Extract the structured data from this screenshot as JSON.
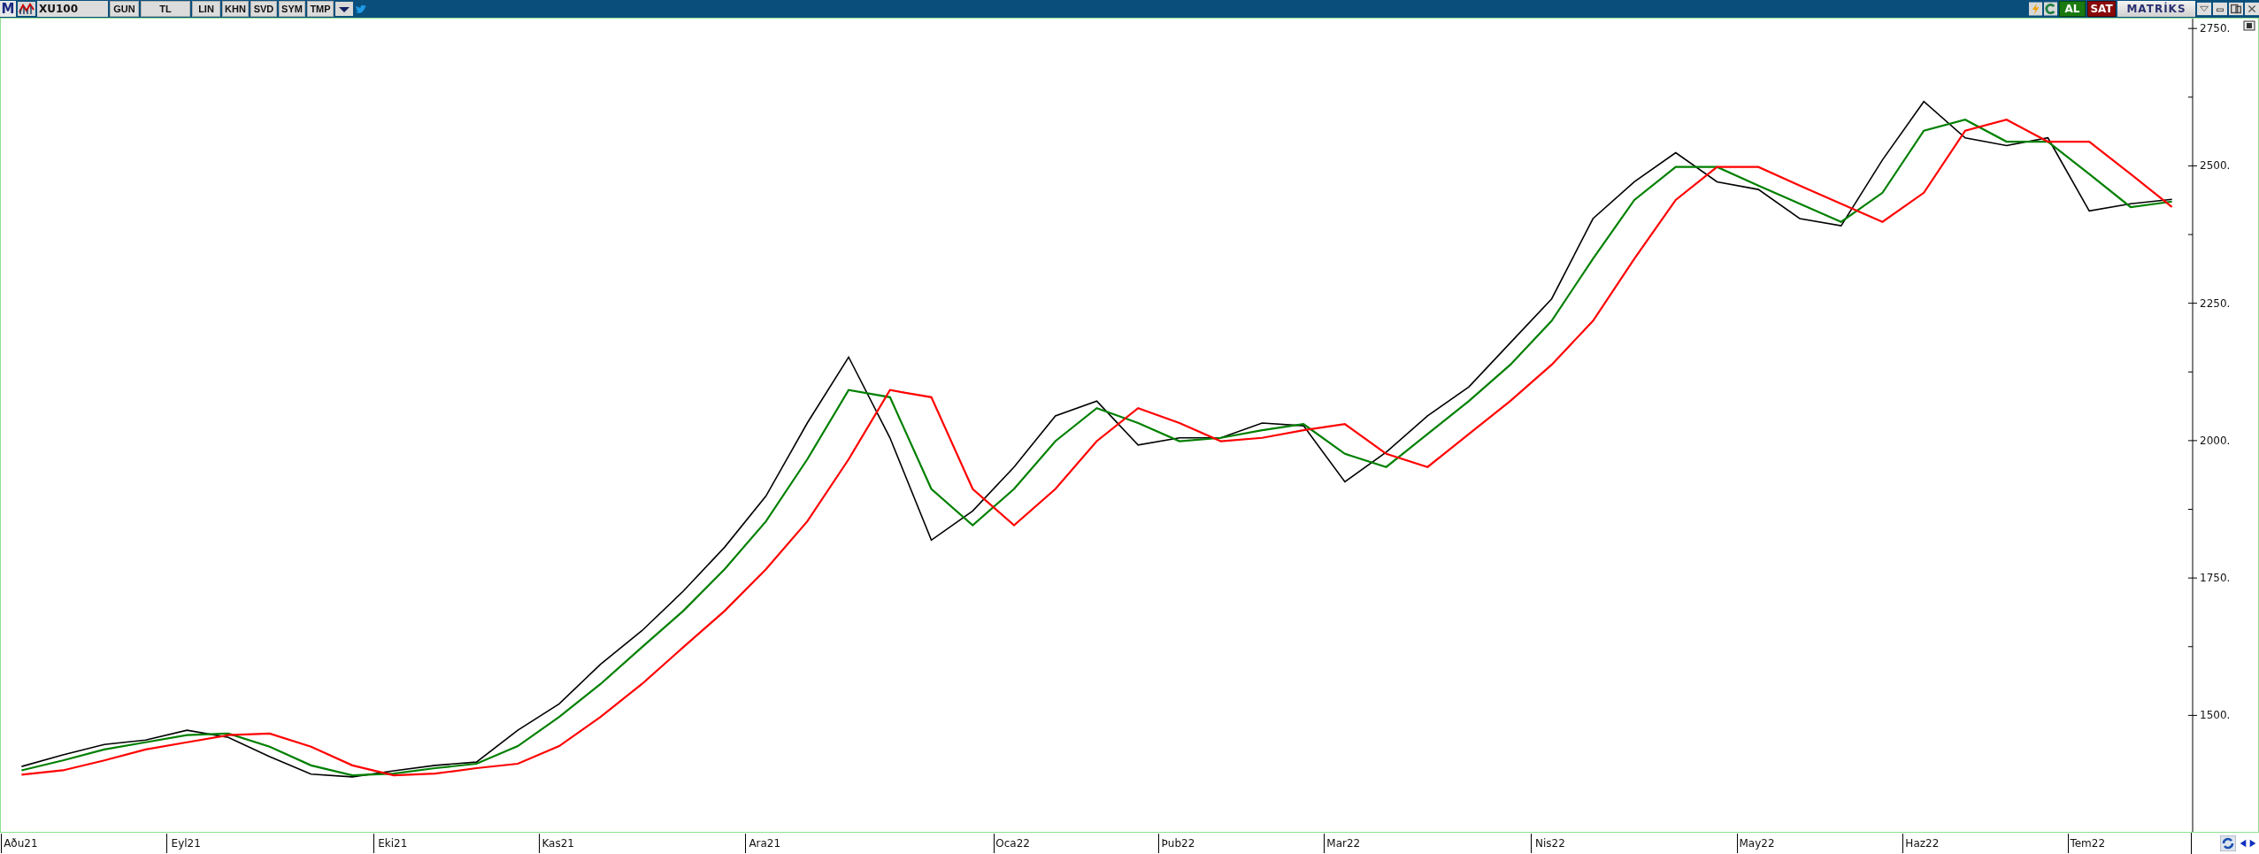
{
  "toolbar": {
    "logo": "M",
    "symbol": "XU100",
    "buttons": [
      "GUN",
      "TL",
      "LIN",
      "KHN",
      "SVD",
      "SYM",
      "TMP"
    ],
    "buy": "AL",
    "sell": "SAT",
    "brand": "MATRİKS"
  },
  "chart": {
    "chart_data": {
      "type": "line",
      "categories": [
        "Aðu21",
        null,
        null,
        null,
        "Eyl21",
        null,
        null,
        null,
        null,
        "Eki21",
        null,
        null,
        null,
        "Kas21",
        null,
        null,
        null,
        null,
        "Ara21",
        null,
        null,
        null,
        null,
        null,
        "Oca22",
        null,
        null,
        null,
        "Þub22",
        null,
        null,
        null,
        "Mar22",
        null,
        null,
        null,
        null,
        "Nis22",
        null,
        null,
        null,
        null,
        "May22",
        null,
        null,
        null,
        "Haz22",
        null,
        null,
        null,
        "Tem22",
        null,
        null
      ],
      "series": [
        {
          "color": "#000000",
          "values": [
            1407,
            1428,
            1447,
            1455,
            1473,
            1460,
            1425,
            1393,
            1388,
            1399,
            1409,
            1415,
            1473,
            1521,
            1593,
            1654,
            1726,
            1806,
            1899,
            2032,
            2152,
            2005,
            1819,
            1872,
            1952,
            2045,
            2072,
            1992,
            2005,
            2005,
            2032,
            2027,
            1925,
            1979,
            2045,
            2098,
            2178,
            2258,
            2404,
            2471,
            2524,
            2471,
            2457,
            2404,
            2391,
            2511,
            2617,
            2551,
            2537,
            2551,
            2418,
            2431,
            2439
          ]
        },
        {
          "color": "#008000",
          "values": [
            1400,
            1418,
            1438,
            1451,
            1464,
            1467,
            1443,
            1409,
            1391,
            1394,
            1404,
            1412,
            1444,
            1497,
            1557,
            1624,
            1690,
            1766,
            1853,
            1966,
            2092,
            2079,
            1912,
            1846,
            1912,
            1999,
            2059,
            2032,
            1999,
            2005,
            2019,
            2030,
            1976,
            1952,
            2012,
            2072,
            2138,
            2218,
            2331,
            2438,
            2498,
            2498,
            2464,
            2431,
            2398,
            2451,
            2564,
            2584,
            2544,
            2544,
            2485,
            2425,
            2435
          ]
        },
        {
          "color": "#ff0000",
          "values": [
            1392,
            1400,
            1418,
            1438,
            1451,
            1464,
            1467,
            1443,
            1409,
            1391,
            1394,
            1404,
            1412,
            1444,
            1497,
            1557,
            1624,
            1690,
            1766,
            1853,
            1966,
            2092,
            2079,
            1912,
            1846,
            1912,
            1999,
            2059,
            2032,
            1999,
            2005,
            2019,
            2030,
            1976,
            1952,
            2012,
            2072,
            2138,
            2218,
            2331,
            2438,
            2498,
            2498,
            2464,
            2431,
            2398,
            2451,
            2564,
            2584,
            2544,
            2544,
            2485,
            2425
          ]
        }
      ],
      "ylim": [
        1288,
        2768
      ],
      "yticks": [
        {
          "value": 1500,
          "label": "1500."
        },
        {
          "value": 1750,
          "label": "1750."
        },
        {
          "value": 2000,
          "label": "2000."
        },
        {
          "value": 2250,
          "label": "2250."
        },
        {
          "value": 2500,
          "label": "2500."
        },
        {
          "value": 2750,
          "label": "2750."
        }
      ]
    }
  }
}
